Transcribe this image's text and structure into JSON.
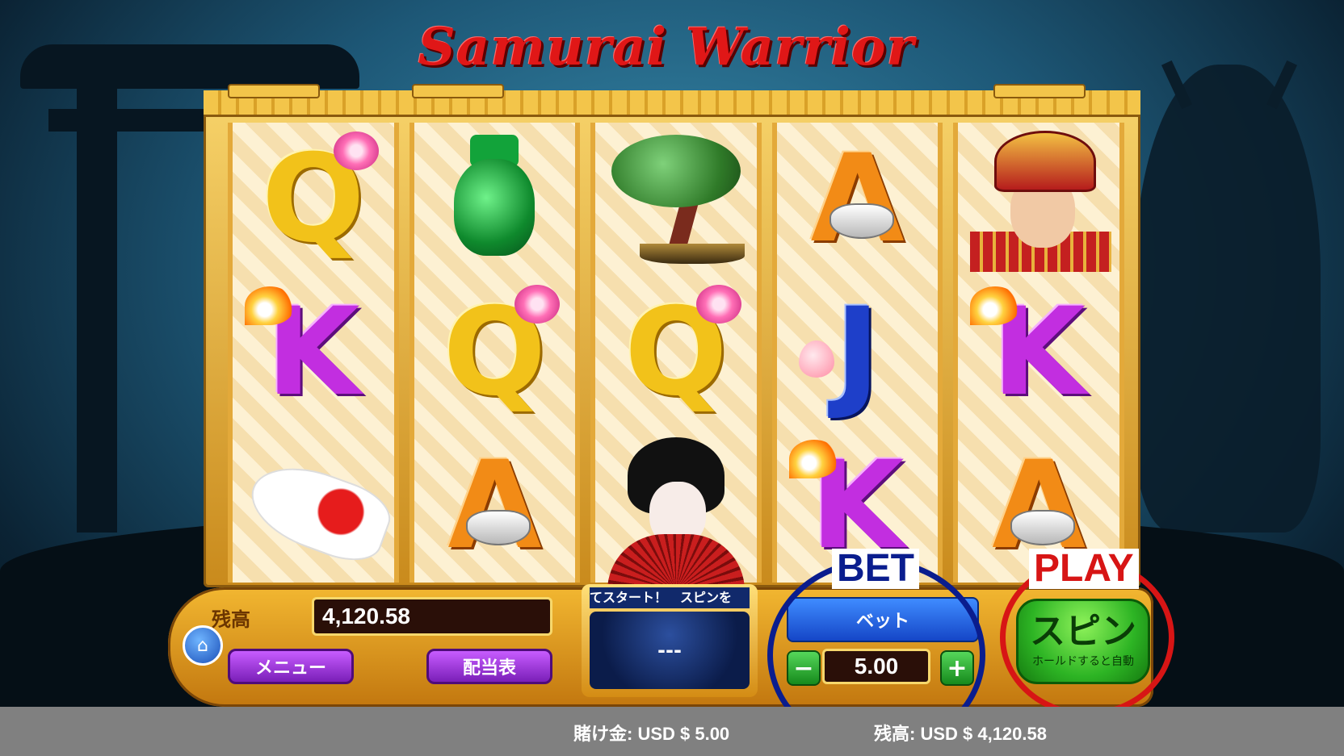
{
  "game": {
    "title": "Samurai Warrior"
  },
  "reels": [
    [
      {
        "type": "letter",
        "glyph": "Q",
        "decor": "flower"
      },
      {
        "type": "letter",
        "glyph": "K",
        "decor": "flame"
      },
      {
        "type": "koi"
      }
    ],
    [
      {
        "type": "vase"
      },
      {
        "type": "letter",
        "glyph": "Q",
        "decor": "flower"
      },
      {
        "type": "letter",
        "glyph": "A",
        "decor": "ingot"
      }
    ],
    [
      {
        "type": "bonsai"
      },
      {
        "type": "letter",
        "glyph": "Q",
        "decor": "flower"
      },
      {
        "type": "geisha"
      }
    ],
    [
      {
        "type": "letter",
        "glyph": "A",
        "decor": "ingot"
      },
      {
        "type": "letter",
        "glyph": "J",
        "decor": "peach"
      },
      {
        "type": "letter",
        "glyph": "K",
        "decor": "flame"
      }
    ],
    [
      {
        "type": "samurai"
      },
      {
        "type": "letter",
        "glyph": "K",
        "decor": "flame"
      },
      {
        "type": "letter",
        "glyph": "A",
        "decor": "ingot"
      }
    ]
  ],
  "console": {
    "balance_label": "残高",
    "balance_value": "4,120.58",
    "menu_label": "メニュー",
    "paytable_label": "配当表",
    "message_scroll": "てスタート！　スピンを",
    "message_display": "---",
    "bet_button_label": "ベット",
    "bet_value": "5.00",
    "minus": "−",
    "plus": "+",
    "spin_label": "スピン",
    "spin_sublabel": "ホールドすると自動",
    "home_icon": "⌂"
  },
  "annotations": {
    "bet": "BET",
    "play": "PLAY",
    "bet_color": "#0a1d8e",
    "play_color": "#d71515"
  },
  "status_bar": {
    "wager_text": "賭け金:  USD $ 5.00",
    "balance_text": "残高:  USD $ 4,120.58"
  }
}
